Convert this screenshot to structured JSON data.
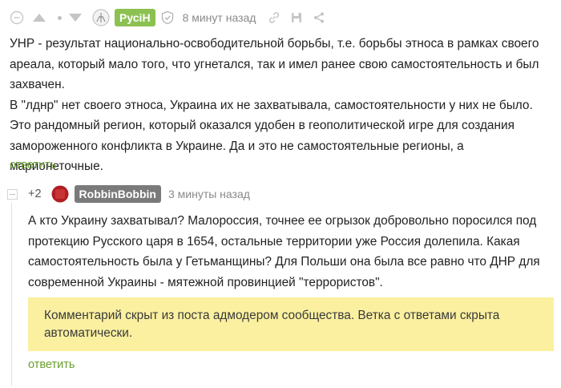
{
  "comment1": {
    "username": "РусіН",
    "user_badge_color": "#8cc152",
    "time": "8 минут назад",
    "paragraphs": [
      "УНР - результат национально-освободительной борьбы, т.е. борьбы этноса в рамках своего ареала, который мало того, что угнетался, так и имел ранее свою самостоятельность и был захвачен.",
      "В \"лднр\" нет своего этноса, Украина их не захватывала, самостоятельности у них не было. Это рандомный регион, который оказался удобен в геополитической игре для создания замороженного конфликта в Украине. Да и это не самостоятельные регионы, а марионеточные."
    ],
    "reply_label": "ответить"
  },
  "comment2": {
    "rating": "+2",
    "username": "RobbinBobbin",
    "user_badge_color": "#7a7a7a",
    "time": "3 минуты назад",
    "text": "А кто Украину захватывал? Малороссия, точнее ее огрызок добровольно поросился под протекцию Русского царя в 1654, остальные территории уже Россия долепила. Какая самостоятельность была у Гетьманщины? Для Польши она была все равно что ДНР для современной Украины - мятежной провинцией \"террористов\".",
    "hidden_notice": "Комментарий скрыт из поста адмодером сообщества. Ветка с ответами скрыта автоматически.",
    "reply_label": "ответить"
  },
  "colors": {
    "accent_green": "#6a9f2e",
    "notice_bg": "#faf0a0"
  }
}
